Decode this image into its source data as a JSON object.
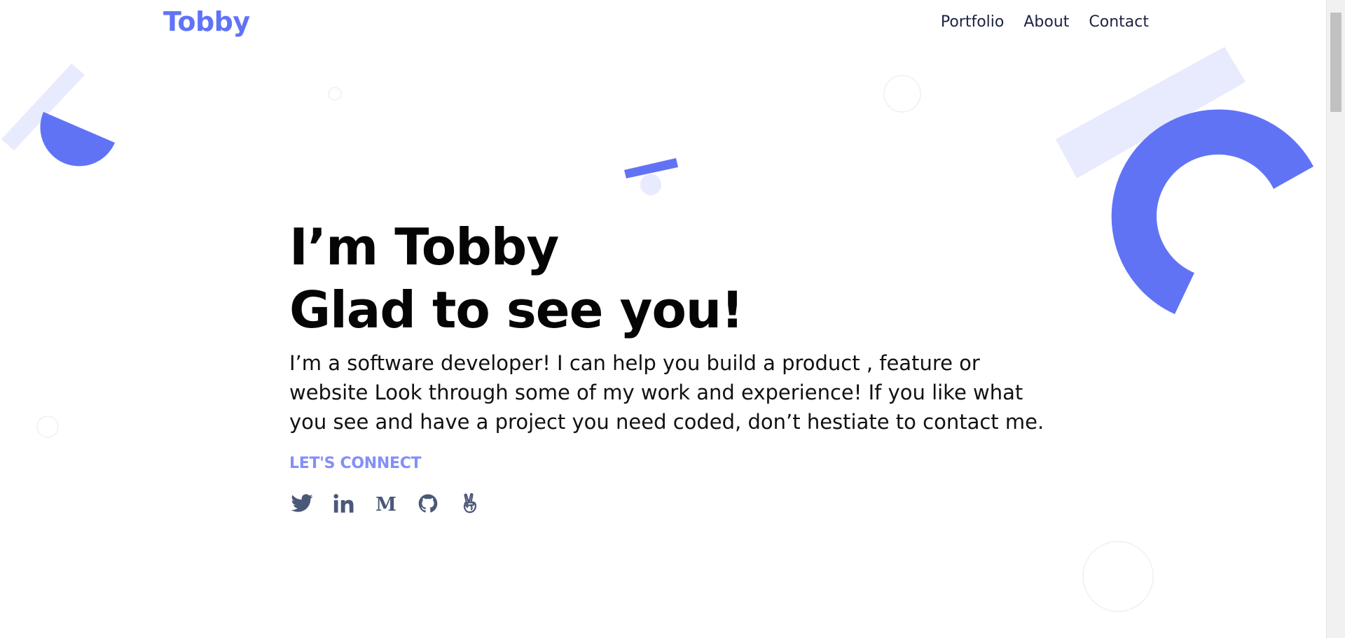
{
  "header": {
    "logo": "Tobby",
    "nav": [
      "Portfolio",
      "About",
      "Contact"
    ]
  },
  "hero": {
    "title_line1": "I’m Tobby",
    "title_line2": "Glad to see you!",
    "description": "I’m a software developer! I can help you build a product , feature or website Look through some of my work and experience! If you like what you see and have a project you need coded, don’t hestiate to contact me.",
    "connect_label": "LET'S CONNECT"
  },
  "socials": [
    {
      "name": "twitter",
      "icon": "twitter-icon"
    },
    {
      "name": "linkedin",
      "icon": "linkedin-icon"
    },
    {
      "name": "medium",
      "icon": "medium-icon"
    },
    {
      "name": "github",
      "icon": "github-icon"
    },
    {
      "name": "angellist",
      "icon": "angellist-icon"
    }
  ],
  "colors": {
    "accent": "#6173f5",
    "accent_light": "#e8eafd",
    "connect": "#8390f7",
    "icon": "#4c5878",
    "nav": "#1c2340"
  }
}
